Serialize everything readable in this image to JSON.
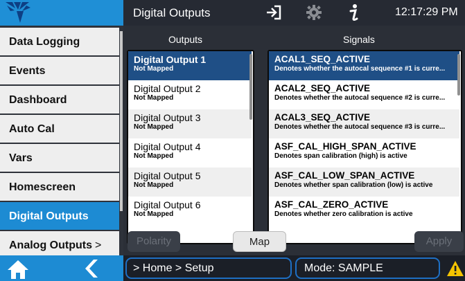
{
  "header": {
    "title": "Digital Outputs",
    "time": "12:17:29 PM",
    "icons": [
      "logo-icon",
      "login-icon",
      "gear-icon",
      "info-icon"
    ]
  },
  "sidebar": {
    "items": [
      {
        "label": "Data Logging"
      },
      {
        "label": "Events"
      },
      {
        "label": "Dashboard"
      },
      {
        "label": "Auto Cal"
      },
      {
        "label": "Vars"
      },
      {
        "label": "Homescreen"
      },
      {
        "label": "Digital Outputs",
        "active": true
      },
      {
        "label": "Analog Outputs",
        "chevron": ">"
      }
    ]
  },
  "outputs": {
    "heading": "Outputs",
    "items": [
      {
        "name": "Digital Output  1",
        "status": "Not Mapped"
      },
      {
        "name": "Digital Output 2",
        "status": "Not Mapped"
      },
      {
        "name": "Digital Output 3",
        "status": "Not Mapped"
      },
      {
        "name": "Digital Output 4",
        "status": "Not Mapped"
      },
      {
        "name": "Digital Output 5",
        "status": "Not Mapped"
      },
      {
        "name": "Digital Output 6",
        "status": "Not Mapped"
      }
    ]
  },
  "signals": {
    "heading": "Signals",
    "items": [
      {
        "name": "ACAL1_SEQ_ACTIVE",
        "desc": "Denotes whether the autocal sequence #1 is curre..."
      },
      {
        "name": "ACAL2_SEQ_ACTIVE",
        "desc": "Denotes whether the autocal sequence #2 is curre..."
      },
      {
        "name": "ACAL3_SEQ_ACTIVE",
        "desc": "Denotes whether the autocal sequence #3 is curre..."
      },
      {
        "name": "ASF_CAL_HIGH_SPAN_ACTIVE",
        "desc": "Denotes span calibration (high) is active"
      },
      {
        "name": "ASF_CAL_LOW_SPAN_ACTIVE",
        "desc": "Denotes whether span calibration (low) is active"
      },
      {
        "name": "ASF_CAL_ZERO_ACTIVE",
        "desc": "Denotes whether zero calibration is active"
      }
    ]
  },
  "buttons": {
    "polarity": "Polarity",
    "map": "Map",
    "apply": "Apply"
  },
  "footer": {
    "breadcrumb": "> Home > Setup",
    "mode": "Mode: SAMPLE",
    "icons": [
      "home-icon",
      "back-icon",
      "warning-icon"
    ]
  },
  "colors": {
    "accent": "#1d8bd3",
    "selected": "#1f4f86",
    "warning": "#f5c400"
  }
}
